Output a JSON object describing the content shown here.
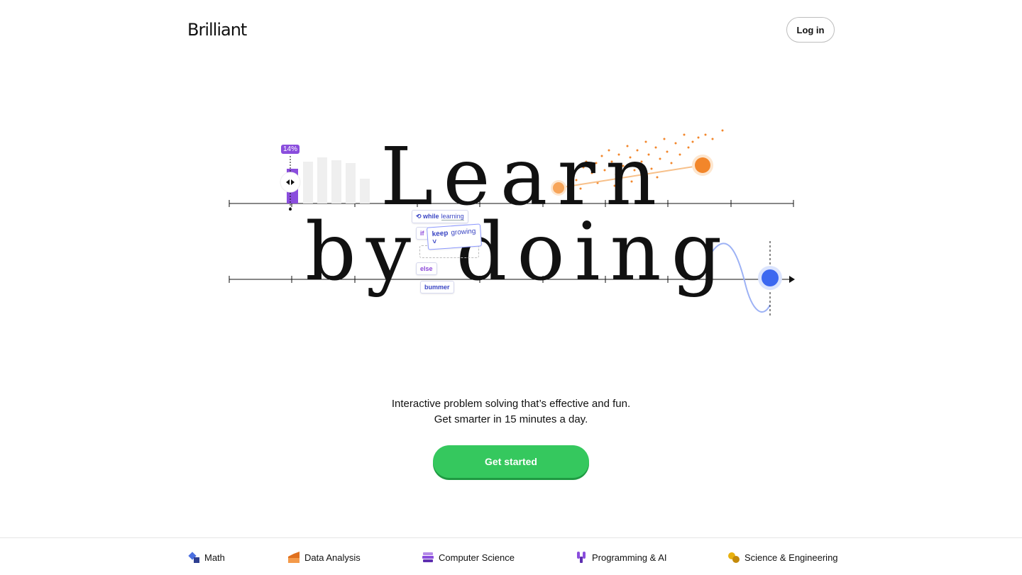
{
  "header": {
    "logo_text": "Brilliant",
    "login_label": "Log in"
  },
  "hero": {
    "line1": "Learn",
    "line2": "by doing",
    "slider_badge": "14%",
    "slider_value_percent": 14,
    "code_while": "while",
    "code_while_cond": "learning",
    "code_if": "if",
    "code_keep": "keep",
    "code_keep_value": "growing",
    "code_else": "else",
    "code_bummer": "bummer",
    "colors": {
      "purple": "#8a4ddd",
      "orange": "#f2862a",
      "blue": "#3c68f0",
      "grey_bars": "#efefef"
    }
  },
  "tagline": {
    "line1": "Interactive problem solving that’s effective and fun.",
    "line2": "Get smarter in 15 minutes a day."
  },
  "cta": {
    "label": "Get started",
    "color": "#35c85e"
  },
  "categories": [
    {
      "label": "Math",
      "icon": "math-icon"
    },
    {
      "label": "Data Analysis",
      "icon": "data-analysis-icon"
    },
    {
      "label": "Computer Science",
      "icon": "computer-science-icon"
    },
    {
      "label": "Programming & AI",
      "icon": "programming-ai-icon"
    },
    {
      "label": "Science & Engineering",
      "icon": "science-engineering-icon"
    }
  ]
}
